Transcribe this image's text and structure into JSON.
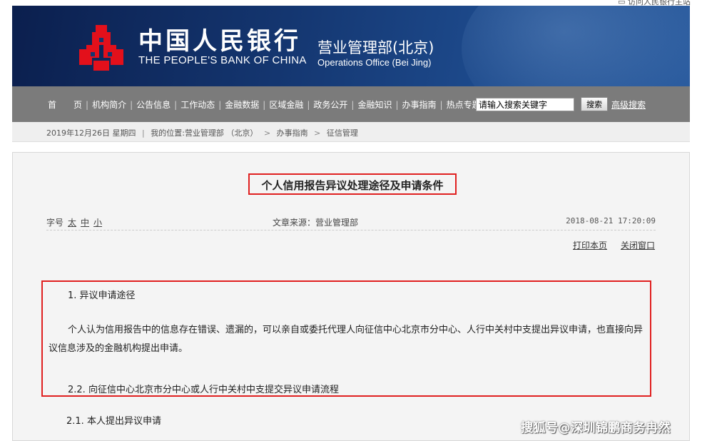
{
  "top_link": "▭ 访问人民银行主站",
  "header": {
    "bank_name_cn": "中国人民银行",
    "bank_name_en": "THE PEOPLE'S BANK OF CHINA",
    "dept_cn": "营业管理部(北京)",
    "dept_en": "Operations Office (Bei Jing)",
    "logo_color": "#e3101b"
  },
  "nav": {
    "items": [
      {
        "label": "首　　页"
      },
      {
        "label": "机构简介"
      },
      {
        "label": "公告信息"
      },
      {
        "label": "工作动态"
      },
      {
        "label": "金融数据"
      },
      {
        "label": "区域金融"
      },
      {
        "label": "政务公开"
      },
      {
        "label": "金融知识"
      },
      {
        "label": "办事指南"
      },
      {
        "label": "热点专题"
      }
    ],
    "search_value": "请输入搜索关键字",
    "search_button": "搜索",
    "advanced_search": "高级搜索"
  },
  "breadcrumb": {
    "date": "2019年12月26日 星期四",
    "location_label": "我的位置:",
    "items": [
      "营业管理部 （北京）",
      "办事指南",
      "征信管理"
    ]
  },
  "article": {
    "title": "个人信用报告异议处理途径及申请条件",
    "font_size_label": "字号",
    "font_sizes": [
      "太",
      "中",
      "小"
    ],
    "source": "文章来源：营业管理部",
    "datetime": "2018-08-21 17:20:09",
    "print_label": "打印本页",
    "close_label": "关闭窗口",
    "heading1": "1. 异议申请途径",
    "paragraph1": "个人认为信用报告中的信息存在错误、遗漏的，可以亲自或委托代理人向征信中心北京市分中心、人行中关村中支提出异议申请，也直接向异议信息涉及的金融机构提出申请。",
    "heading2": "2.2. 向征信中心北京市分中心或人行中关村中支提交异议申请流程",
    "heading3": "2.1. 本人提出异议申请"
  },
  "watermark": "搜狐号@深圳锦鹏商务冉然"
}
